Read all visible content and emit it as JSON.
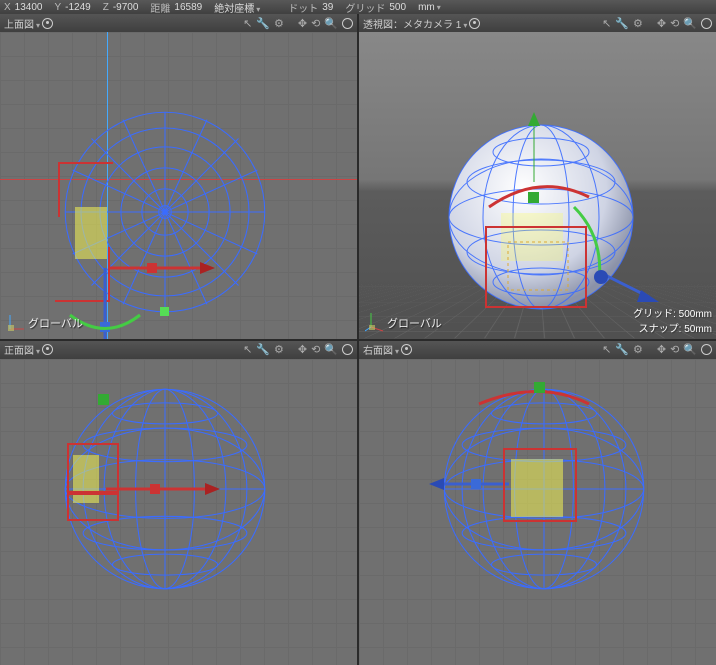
{
  "status": {
    "x_label": "X",
    "x_value": "13400",
    "y_label": "Y",
    "y_value": "-1249",
    "z_label": "Z",
    "z_value": "-9700",
    "dist_label": "距離",
    "dist_value": "16589",
    "coord_system": "絶対座標",
    "dot_label": "ドット",
    "dot_value": "39",
    "grid_label": "グリッド",
    "grid_value": "500",
    "unit": "mm"
  },
  "viewports": {
    "top": {
      "title": "上面図",
      "label": "グローバル"
    },
    "persp": {
      "title": "透視図：メタカメラ 1",
      "label": "グローバル",
      "grid_info": "グリッド: 500mm",
      "snap_info": "スナップ: 50mm"
    },
    "front": {
      "title": "正面図"
    },
    "right": {
      "title": "右面図"
    }
  },
  "tools": {
    "t1": "↖",
    "t2": "🔧",
    "t3": "⚙",
    "t4": "✥",
    "t5": "⟲",
    "t6": "🔍"
  },
  "icons": {
    "ring": "ring-icon",
    "chevron": "▾"
  }
}
